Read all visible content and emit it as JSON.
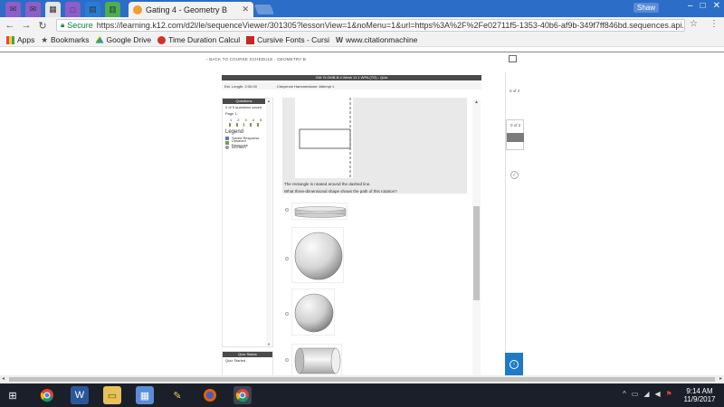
{
  "browser": {
    "active_tab_title": "Gating 4 - Geometry B",
    "profile_label": "Shaw",
    "omnibox": {
      "secure_label": "Secure",
      "url": "https://learning.k12.com/d2l/le/sequenceViewer/301305?lessonView=1&noMenu=1&url=https%3A%2F%2Fe02711f5-1353-40b6-af9b-349f7ff846bd.sequences.api.br..."
    },
    "bookmarks": [
      "Apps",
      "Bookmarks",
      "Google Drive",
      "Time Duration Calcul",
      "Cursive Fonts - Cursi",
      "www.citationmachine"
    ]
  },
  "page": {
    "back_link": "BACK TO COURSE SCHEDULE · GEOMETRY B",
    "quiz_header": "GM: B-GMB-B.4 Week 11.1 WPA (TG) - Quiz",
    "meta": {
      "est_length": "Est. Length: 2:00:00",
      "attempt": "Cheyenne Hammerstone: Attempt 1"
    },
    "side": {
      "title": "Questions",
      "saved": "0 of 5 questions saved",
      "page": "Page 1:",
      "numbers": [
        "1",
        "2",
        "3",
        "4",
        "5"
      ],
      "legend_heading": "Legend",
      "legend": [
        "Saved Response",
        "Unsaved Response",
        "Info Item"
      ]
    },
    "quiz_status": {
      "title": "Quiz Status",
      "text": "Quiz Started"
    },
    "question": {
      "line1": "The rectangle is rotated around the dashed line.",
      "line2": "What three-dimensional shape shows the path of this rotation?"
    },
    "right_panel": {
      "top_label": "0 of 2",
      "sel_label": "0 of 2"
    }
  },
  "taskbar": {
    "time": "9:14 AM",
    "date": "11/9/2017"
  },
  "colors": {
    "chrome_blue": "#2b6dc7",
    "header_dark": "#4a4a4a",
    "next_blue": "#1e79c8"
  }
}
